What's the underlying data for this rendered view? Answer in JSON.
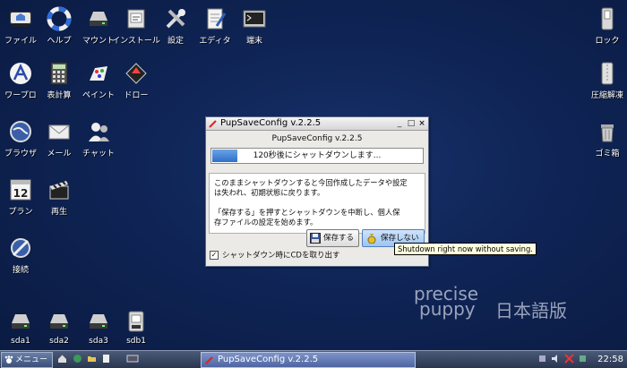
{
  "desktop": {
    "icons": [
      {
        "label": "ファイル",
        "icon": "drive-icon"
      },
      {
        "label": "ヘルプ",
        "icon": "lifebuoy-icon"
      },
      {
        "label": "マウント",
        "icon": "drive-icon"
      },
      {
        "label": "インストール",
        "icon": "package-icon"
      },
      {
        "label": "設定",
        "icon": "tools-icon"
      },
      {
        "label": "エディタ",
        "icon": "notepad-icon"
      },
      {
        "label": "端末",
        "icon": "terminal-icon"
      },
      {
        "label": "ロック",
        "icon": "lock-icon"
      },
      {
        "label": "ワープロ",
        "icon": "wordprocessor-icon"
      },
      {
        "label": "表計算",
        "icon": "calculator-icon"
      },
      {
        "label": "ペイント",
        "icon": "paint-icon"
      },
      {
        "label": "ドロー",
        "icon": "draw-icon"
      },
      {
        "label": "圧縮解凍",
        "icon": "archive-icon"
      },
      {
        "label": "ブラウザ",
        "icon": "globe-icon"
      },
      {
        "label": "メール",
        "icon": "mail-icon"
      },
      {
        "label": "チャット",
        "icon": "chat-icon"
      },
      {
        "label": "ゴミ箱",
        "icon": "trash-icon"
      },
      {
        "label": "プラン",
        "icon": "calendar-icon",
        "glyph": "12"
      },
      {
        "label": "再生",
        "icon": "clapper-icon"
      },
      {
        "label": "接続",
        "icon": "connect-icon"
      },
      {
        "label": "sda1",
        "icon": "drive-icon"
      },
      {
        "label": "sda2",
        "icon": "drive-icon"
      },
      {
        "label": "sda3",
        "icon": "drive-icon"
      },
      {
        "label": "sdb1",
        "icon": "usb-drive-icon"
      }
    ],
    "watermark": {
      "line1": "precise",
      "line2": "puppy",
      "line3": "日本語版"
    }
  },
  "window": {
    "title": "PupSaveConfig v.2.2.5",
    "heading": "PupSaveConfig v.2.2.5",
    "progress_text": "120秒後にシャットダウンします...",
    "progress_fraction": 0.12,
    "message_lines": [
      "このままシャットダウンすると今回作成したデータや設定",
      "は失われ、初期状態に戻ります。",
      "",
      "「保存する」を押すとシャットダウンを中断し、個人保",
      "存ファイルの設定を始めます。"
    ],
    "save_button": "保存する",
    "nosave_button": "保存しない",
    "checkbox_label": "シャットダウン時にCDを取り出す",
    "checkbox_checked": "✓",
    "controls": {
      "close": "×",
      "maximize": "□",
      "minimize": "_"
    }
  },
  "tooltip": "Shutdown right now without saving.",
  "taskbar": {
    "menu_label": "メニュー",
    "task_label": "PupSaveConfig v.2.2.5",
    "clock": "22:58"
  },
  "colors": {
    "desktop": "#0f2455",
    "accent": "#2f6fc8",
    "taskbar": "#2a3650"
  }
}
